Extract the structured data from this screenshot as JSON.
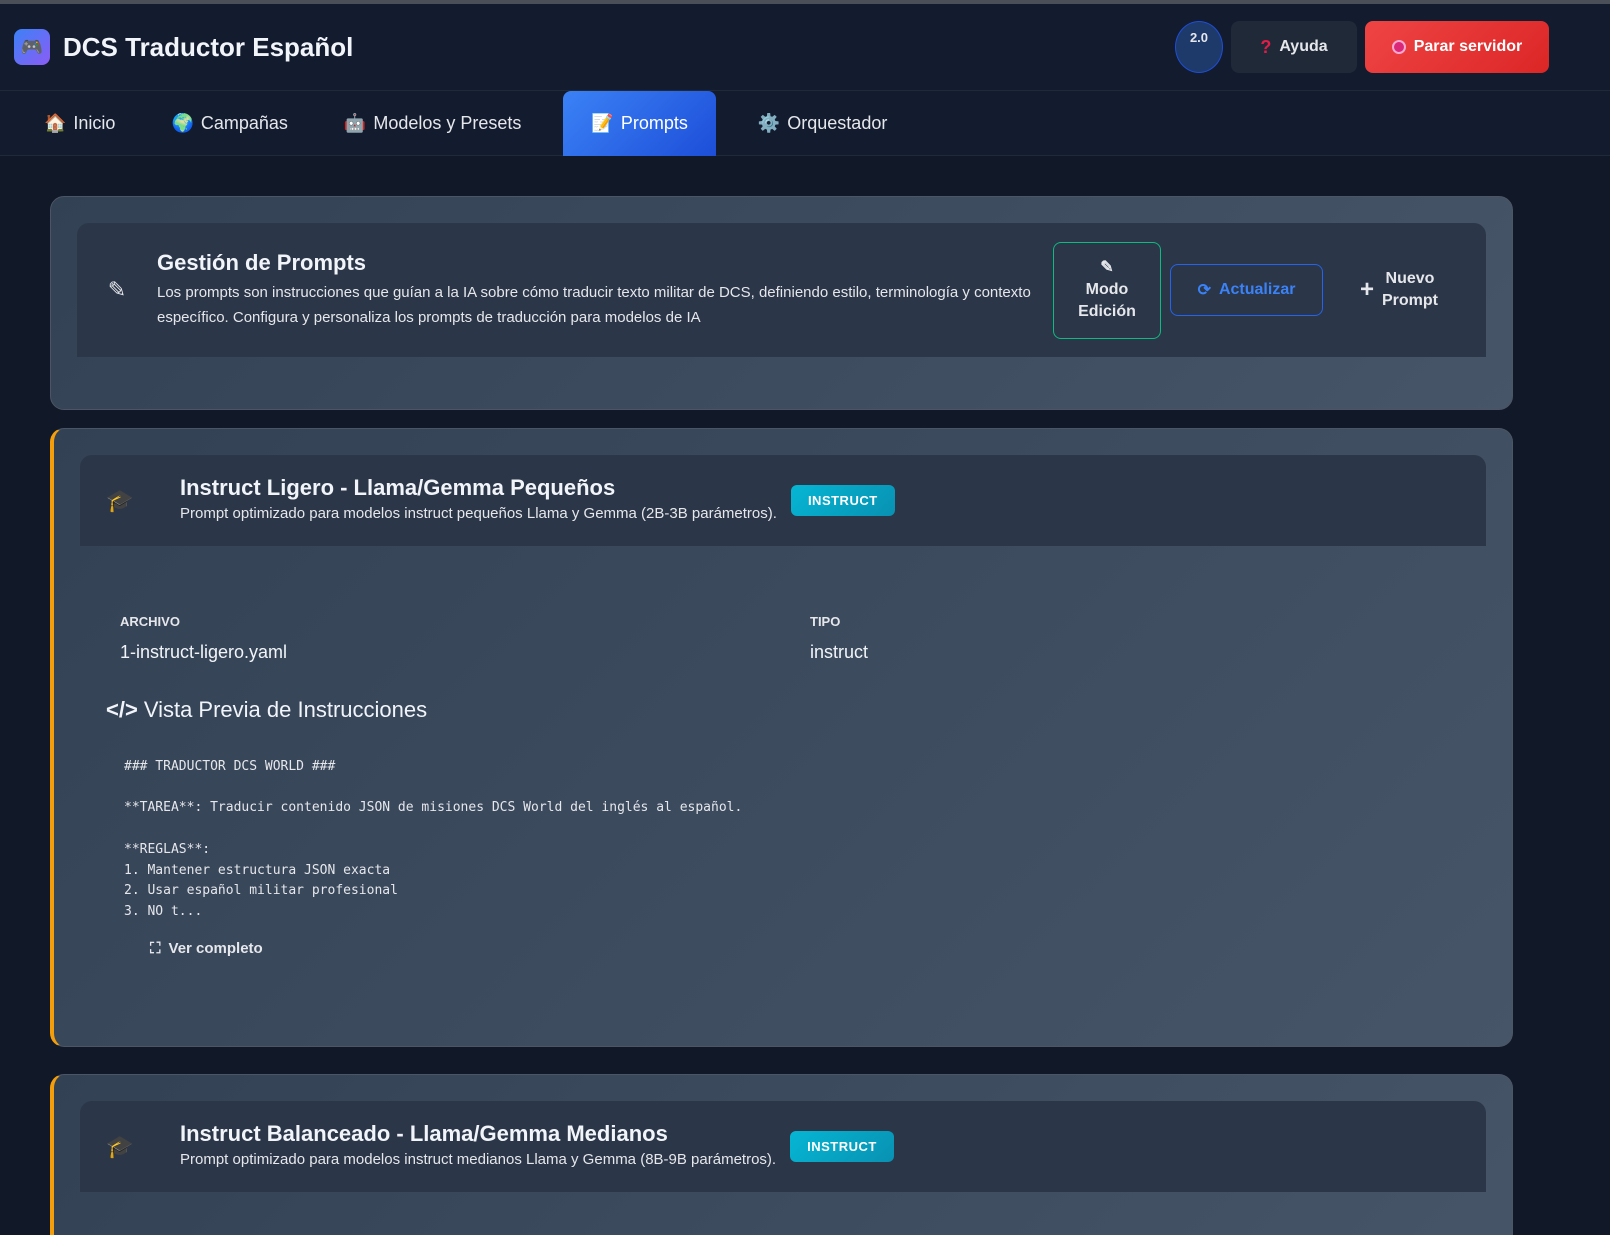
{
  "header": {
    "title": "DCS Traductor Español",
    "version": "2.0",
    "help": "Ayuda",
    "stop": "Parar servidor"
  },
  "nav": [
    {
      "icon": "🏠",
      "label": "Inicio"
    },
    {
      "icon": "🌍",
      "label": "Campañas"
    },
    {
      "icon": "🤖",
      "label": "Modelos y Presets"
    },
    {
      "icon": "📝",
      "label": "Prompts"
    },
    {
      "icon": "⚙️",
      "label": "Orquestador"
    }
  ],
  "manage": {
    "title": "Gestión de Prompts",
    "desc": "Los prompts son instrucciones que guían a la IA sobre cómo traducir texto militar de DCS, definiendo estilo, terminología y contexto específico. Configura y personaliza los prompts de traducción para modelos de IA",
    "edit_mode": [
      "Modo",
      "Edición"
    ],
    "refresh": "Actualizar",
    "new": [
      "Nuevo",
      "Prompt"
    ]
  },
  "prompts": [
    {
      "title": "Instruct Ligero - Llama/Gemma Pequeños",
      "desc": "Prompt optimizado para modelos instruct pequeños Llama y Gemma (2B-3B parámetros).",
      "badge": "INSTRUCT",
      "file_label": "ARCHIVO",
      "file": "1-instruct-ligero.yaml",
      "type_label": "TIPO",
      "type": "instruct",
      "preview_title": "Vista Previa de Instrucciones",
      "preview": "### TRADUCTOR DCS WORLD ###\n\n**TAREA**: Traducir contenido JSON de misiones DCS World del inglés al español.\n\n**REGLAS**:\n1. Mantener estructura JSON exacta\n2. Usar español militar profesional\n3. NO t...",
      "view_full": "Ver completo"
    },
    {
      "title": "Instruct Balanceado - Llama/Gemma Medianos",
      "desc": "Prompt optimizado para modelos instruct medianos Llama y Gemma (8B-9B parámetros).",
      "badge": "INSTRUCT"
    }
  ]
}
